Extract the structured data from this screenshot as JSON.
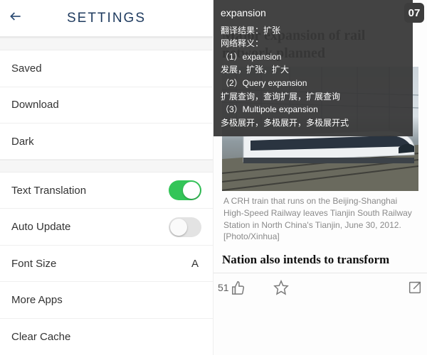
{
  "left": {
    "title": "SETTINGS",
    "rows": {
      "saved": "Saved",
      "download": "Download",
      "dark": "Dark",
      "text_translation": "Text Translation",
      "auto_update": "Auto Update",
      "font_size": "Font Size",
      "font_size_value": "A",
      "more_apps": "More Apps",
      "clear_cache": "Clear Cache"
    },
    "toggles": {
      "text_translation": true,
      "auto_update": false
    }
  },
  "right": {
    "overlay": {
      "headword": "expansion",
      "line1": "翻译结果：扩张",
      "line2": "网络释义：",
      "line3": "（1）expansion",
      "line4": "发展，扩张，扩大",
      "line5": "（2）Query expansion",
      "line6": "扩展查询，查询扩展，扩展查询",
      "line7": "（3）Multipole expansion",
      "line8": "多极展开，多极展开，多极展开式"
    },
    "logo": "07",
    "headline": "Major expansion of rail network planned",
    "caption": "A CRH train that runs on the Beijing-Shanghai High-Speed Railway leaves Tianjin South Railway Station in North China's Tianjin, June 30, 2012. [Photo/Xinhua]",
    "subhead": "Nation also intends to transform",
    "likes": "51"
  }
}
